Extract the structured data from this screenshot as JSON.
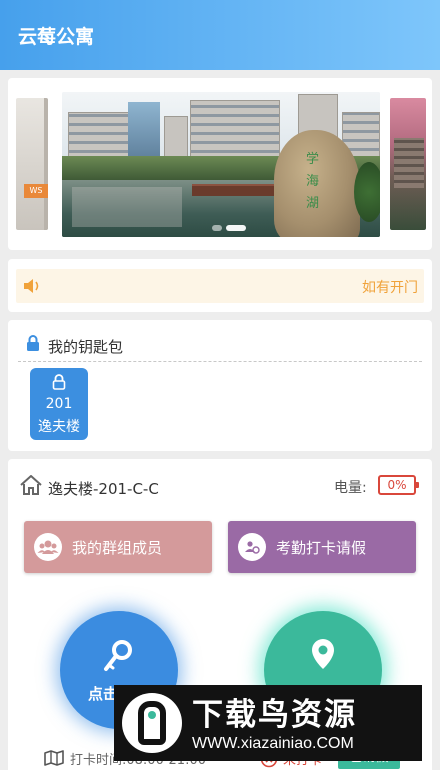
{
  "header": {
    "title": "云莓公寓"
  },
  "banner": {
    "left_tag": "WS",
    "rock_text": [
      "学",
      "海",
      "湖"
    ],
    "active_dot": 0,
    "dot_count": 2
  },
  "notice": {
    "text": "如有开门"
  },
  "keys": {
    "section_title": "我的钥匙包",
    "items": [
      {
        "room": "201",
        "building": "逸夫楼"
      }
    ]
  },
  "room": {
    "title": "逸夫楼-201-C-C",
    "power_label": "电量:",
    "power_value": "0%"
  },
  "actions": {
    "group_members": "我的群组成员",
    "attendance": "考勤打卡请假",
    "open_door": "点击",
    "checkin_time": "打卡时间:08:00-21:00",
    "checkin_status": "未打卡",
    "leave_status": "已请假"
  },
  "colors": {
    "accent": "#3b8ce0",
    "checkin": "#3bb99b",
    "warning": "#f0a23a",
    "danger": "#d9473b"
  },
  "watermark": {
    "title": "下载鸟资源",
    "url": "WWW.xiazainiao.COM"
  }
}
